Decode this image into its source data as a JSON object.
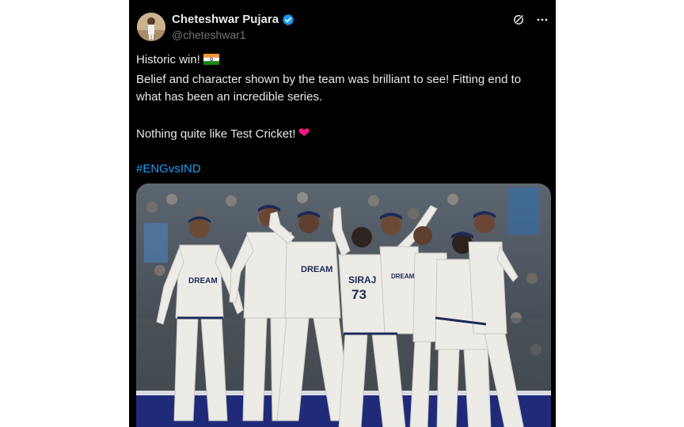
{
  "author": {
    "display_name": "Cheteshwar Pujara",
    "handle": "@cheteshwar1",
    "verified": true
  },
  "icons": {
    "grok": "grok-icon",
    "more": "more-icon",
    "verified": "verified-badge-icon",
    "flag": "india-flag-emoji",
    "heart": "red-heart-emoji"
  },
  "tweet": {
    "line1": "Historic win!",
    "line2": "Belief and character shown by the team was brilliant to see! Fitting end to what has been an incredible series.",
    "line3": "Nothing quite like Test Cricket!",
    "heart": "❤",
    "hashtag": "#ENGvsIND"
  },
  "media": {
    "description_visible_text": [
      "DREAM11",
      "DREAM11",
      "SIRAJ",
      "73",
      "DREAM11"
    ],
    "shirt_text_1": "DREAM",
    "shirt_text_2": "DREAM",
    "shirt_name": "SIRAJ",
    "shirt_number": "73",
    "shirt_text_3": "DREAM"
  },
  "colors": {
    "background": "#000000",
    "text": "#e7e9ea",
    "secondary": "#71767b",
    "link": "#1d9bf0",
    "verified": "#1d9bf0",
    "heart": "#f91880"
  }
}
